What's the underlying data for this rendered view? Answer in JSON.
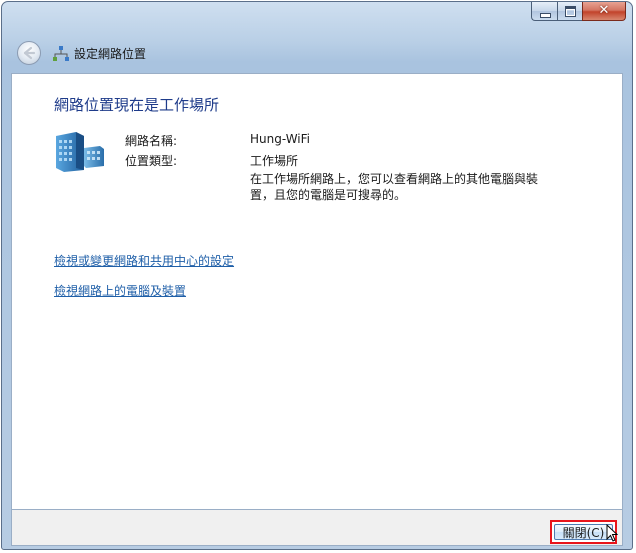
{
  "window": {
    "title": "設定網路位置",
    "caption_close": "✕"
  },
  "main": {
    "headline": "網路位置現在是工作場所",
    "network_name_label": "網路名稱:",
    "network_name_value": "Hung-WiFi",
    "location_type_label": "位置類型:",
    "location_type_value": "工作場所",
    "description": "在工作場所網路上，您可以查看網路上的其他電腦與裝置，且您的電腦是可搜尋的。",
    "links": [
      {
        "label": "檢視或變更網路和共用中心的設定"
      },
      {
        "label": "檢視網路上的電腦及裝置"
      }
    ]
  },
  "footer": {
    "close_label": "關閉(C)"
  },
  "colors": {
    "headline": "#1e3b8a",
    "link": "#1f5fa8",
    "highlight_box": "#e8141b"
  }
}
